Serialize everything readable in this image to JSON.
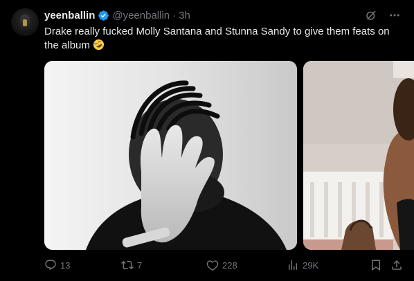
{
  "tweet": {
    "display_name": "yeenballin",
    "handle": "@yeenballin",
    "separator": "·",
    "time": "3h",
    "text": "Drake really fucked Molly Santana and Stunna Sandy to give them feats on the album",
    "emoji": "rolling-on-floor-laughing-emoji"
  },
  "actions": {
    "replies": "13",
    "reposts": "7",
    "likes": "228",
    "views": "29K"
  },
  "colors": {
    "background": "#000000",
    "primary_text": "#e7e9ea",
    "secondary_text": "#71767b",
    "verified_blue": "#1d9bf0"
  }
}
